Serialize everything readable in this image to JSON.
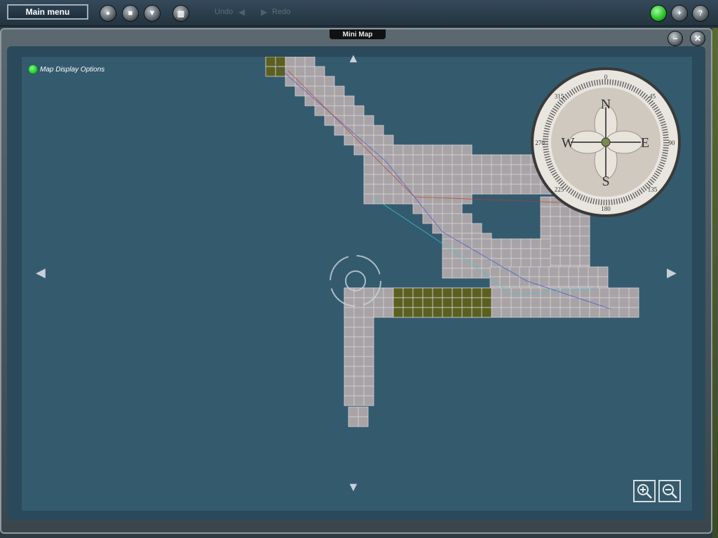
{
  "toolbar": {
    "main_menu_label": "Main menu",
    "undo_label": "Undo",
    "redo_label": "Redo",
    "add_symbol": "+",
    "help_symbol": "?"
  },
  "window": {
    "title": "Mini Map",
    "minimize_symbol": "−",
    "close_symbol": "✕"
  },
  "map": {
    "display_options_label": "Map Display Options",
    "compass": {
      "n": "N",
      "s": "S",
      "e": "E",
      "w": "W"
    },
    "compass_ticks": [
      "0",
      "45",
      "90",
      "135",
      "180",
      "225",
      "270",
      "315"
    ]
  },
  "colors": {
    "water": "#345a6e",
    "tile_grey": "#a7a3a6",
    "tile_terrain": "#5b6020",
    "accent_green": "#16e016"
  }
}
